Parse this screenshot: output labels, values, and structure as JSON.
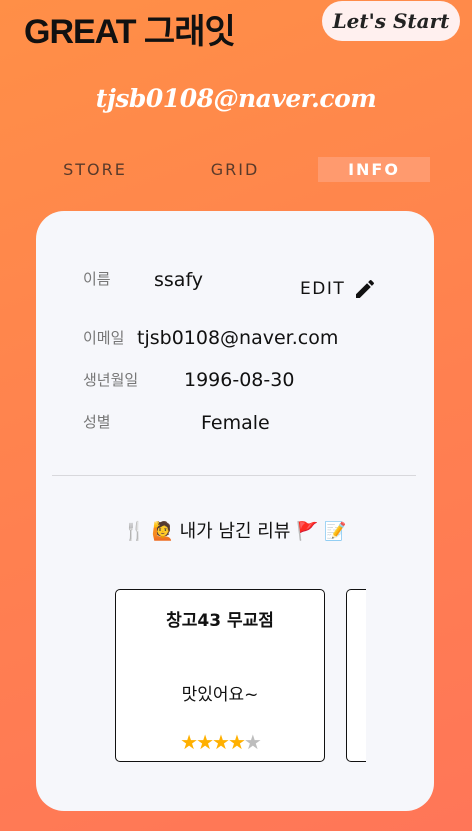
{
  "header": {
    "logo": "GREAT 그래잇",
    "start_button": "Let's Start"
  },
  "user_email_heading": "tjsb0108@naver.com",
  "tabs": [
    {
      "label": "STORE"
    },
    {
      "label": "GRID"
    },
    {
      "label": "INFO",
      "active": true
    }
  ],
  "profile": {
    "name_label": "이름",
    "name_value": "ssafy",
    "edit_label": "EDIT",
    "email_label": "이메일",
    "email_value": "tjsb0108@naver.com",
    "birth_label": "생년월일",
    "birth_value": "1996-08-30",
    "gender_label": "성별",
    "gender_value": "Female"
  },
  "reviews": {
    "title": "🍴 🙋 내가 남긴 리뷰 🚩 📝",
    "items": [
      {
        "store": "창고43 무교점",
        "comment": "맛있어요~",
        "rating": 4,
        "max_rating": 5
      }
    ]
  },
  "colors": {
    "background_start": "#ff8f47",
    "background_end": "#ff7658",
    "active_tab": "#ff9a6e",
    "card": "#f6f7fb",
    "star": "#ffb000"
  }
}
